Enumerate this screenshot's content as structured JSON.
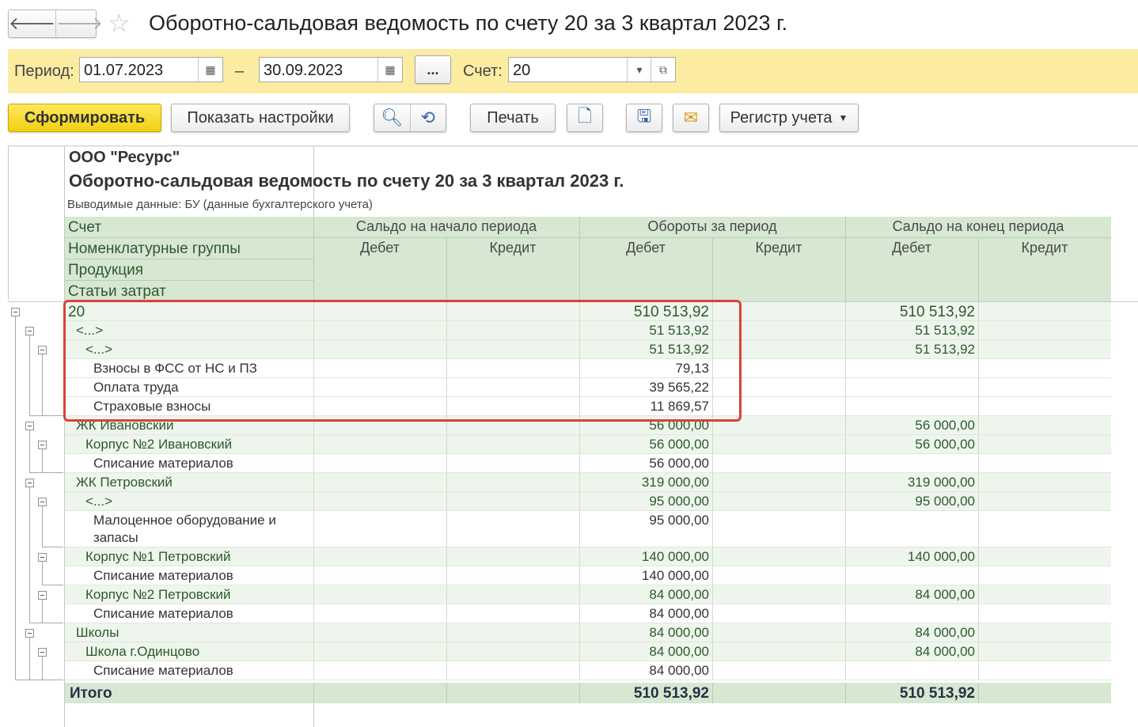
{
  "window": {
    "title": "Оборотно-сальдовая ведомость по счету 20 за 3 квартал 2023 г.",
    "back_icon": "🡐",
    "forward_icon": "🡒"
  },
  "params": {
    "period_label": "Период:",
    "date_from": "01.07.2023",
    "dash": "–",
    "date_to": "30.09.2023",
    "ellipsis": "...",
    "account_label": "Счет:",
    "account_value": "20"
  },
  "toolbar": {
    "generate": "Сформировать",
    "show_settings": "Показать настройки",
    "print": "Печать",
    "register": "Регистр учета"
  },
  "report": {
    "org": "ООО \"Ресурс\"",
    "title": "Оборотно-сальдовая ведомость по счету 20 за 3 квартал 2023 г.",
    "note": "Выводимые данные: БУ (данные бухгалтерского учета)",
    "headers": {
      "account": "Счет",
      "nomenclature": "Номенклатурные группы",
      "product": "Продукция",
      "cost_items": "Статьи затрат",
      "opening": "Сальдо на начало периода",
      "turnover": "Обороты за период",
      "closing": "Сальдо на конец периода",
      "debit": "Дебет",
      "credit": "Кредит"
    },
    "rows": [
      {
        "name": "20",
        "level": 0,
        "type": "grp",
        "t_debit": "510 513,92",
        "c_debit": "510 513,92"
      },
      {
        "name": "<...>",
        "level": 1,
        "type": "grp",
        "t_debit": "51 513,92",
        "c_debit": "51 513,92"
      },
      {
        "name": "<...>",
        "level": 2,
        "type": "grp",
        "t_debit": "51 513,92",
        "c_debit": "51 513,92"
      },
      {
        "name": "Взносы в ФСС от НС и ПЗ",
        "level": 3,
        "type": "leaf",
        "t_debit": "79,13",
        "c_debit": ""
      },
      {
        "name": "Оплата труда",
        "level": 3,
        "type": "leaf",
        "t_debit": "39 565,22",
        "c_debit": ""
      },
      {
        "name": "Страховые взносы",
        "level": 3,
        "type": "leaf",
        "t_debit": "11 869,57",
        "c_debit": ""
      },
      {
        "name": "ЖК Ивановский",
        "level": 1,
        "type": "grp",
        "t_debit": "56 000,00",
        "c_debit": "56 000,00"
      },
      {
        "name": "Корпус №2 Ивановский",
        "level": 2,
        "type": "grp",
        "t_debit": "56 000,00",
        "c_debit": "56 000,00"
      },
      {
        "name": "Списание материалов",
        "level": 3,
        "type": "leaf",
        "t_debit": "56 000,00",
        "c_debit": ""
      },
      {
        "name": "ЖК Петровский",
        "level": 1,
        "type": "grp",
        "t_debit": "319 000,00",
        "c_debit": "319 000,00"
      },
      {
        "name": "<...>",
        "level": 2,
        "type": "grp",
        "t_debit": "95 000,00",
        "c_debit": "95 000,00"
      },
      {
        "name": "Малоценное оборудование и",
        "name2": "запасы",
        "level": 3,
        "type": "leaf",
        "t_debit": "95 000,00",
        "c_debit": ""
      },
      {
        "name": "Корпус №1 Петровский",
        "level": 2,
        "type": "grp",
        "t_debit": "140 000,00",
        "c_debit": "140 000,00"
      },
      {
        "name": "Списание материалов",
        "level": 3,
        "type": "leaf",
        "t_debit": "140 000,00",
        "c_debit": ""
      },
      {
        "name": "Корпус №2 Петровский",
        "level": 2,
        "type": "grp",
        "t_debit": "84 000,00",
        "c_debit": "84 000,00"
      },
      {
        "name": "Списание материалов",
        "level": 3,
        "type": "leaf",
        "t_debit": "84 000,00",
        "c_debit": ""
      },
      {
        "name": "Школы",
        "level": 1,
        "type": "grp",
        "t_debit": "84 000,00",
        "c_debit": "84 000,00"
      },
      {
        "name": "Школа г.Одинцово",
        "level": 2,
        "type": "grp",
        "t_debit": "84 000,00",
        "c_debit": "84 000,00"
      },
      {
        "name": "Списание материалов",
        "level": 3,
        "type": "leaf",
        "t_debit": "84 000,00",
        "c_debit": ""
      }
    ],
    "total": {
      "name": "Итого",
      "t_debit": "510 513,92",
      "c_debit": "510 513,92"
    }
  },
  "colors": {
    "header_bg": "#d6e7d2",
    "param_bar": "#fbeca2",
    "primary_button": "#f0cf12",
    "highlight": "#d9423c"
  }
}
